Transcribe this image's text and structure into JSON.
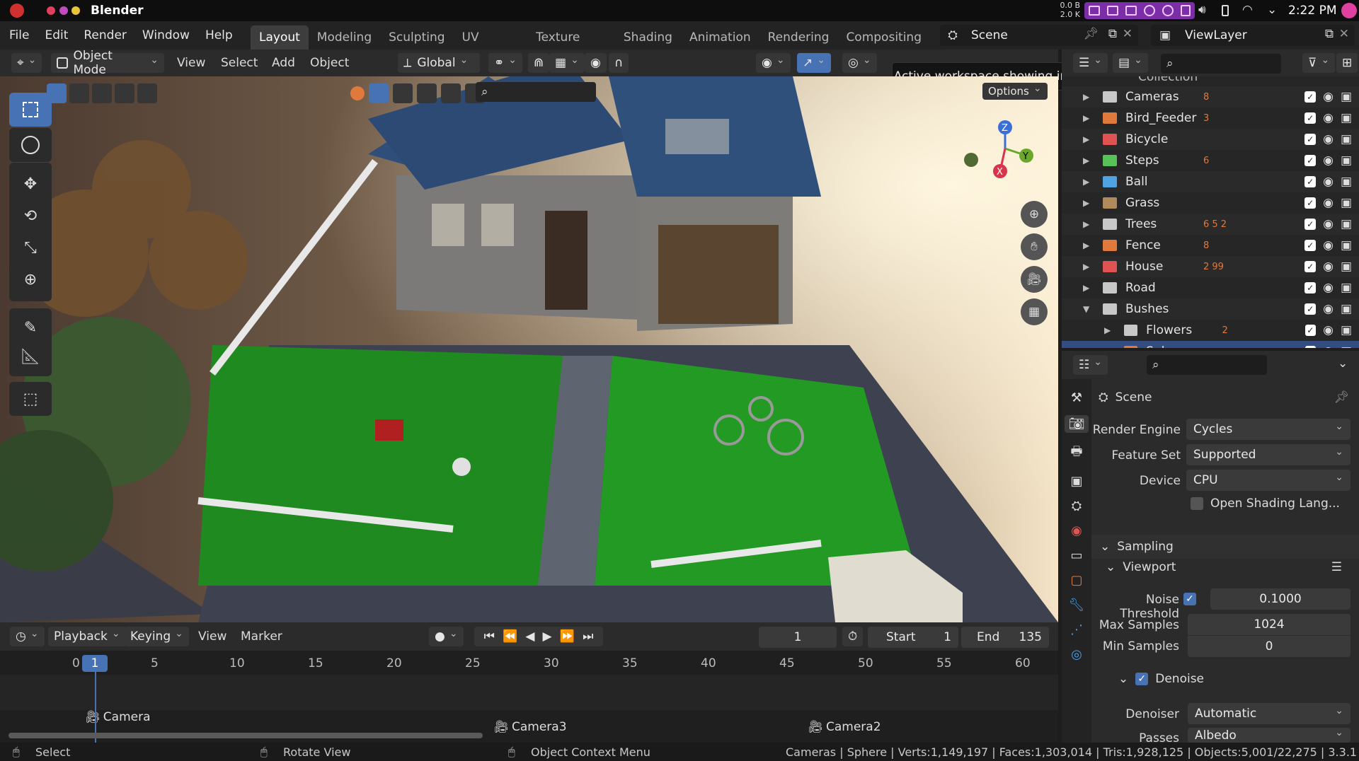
{
  "system": {
    "app_name": "Blender",
    "net_up": "0.0 B",
    "net_down": "2.0 K",
    "time": "2:22 PM"
  },
  "menu": [
    "File",
    "Edit",
    "Render",
    "Window",
    "Help"
  ],
  "workspaces": [
    "Layout",
    "Modeling",
    "Sculpting",
    "UV Editing",
    "Texture Paint",
    "Shading",
    "Animation",
    "Rendering",
    "Compositing"
  ],
  "active_workspace": "Layout",
  "scene_name": "Scene",
  "view_layer": "ViewLayer",
  "tooltip": "Active workspace showing in the window.",
  "viewport_header": {
    "mode": "Object Mode",
    "view": "View",
    "select": "Select",
    "add": "Add",
    "object": "Object",
    "orientation": "Global",
    "options": "Options"
  },
  "outliner": {
    "partial_top": "Collection",
    "rows": [
      {
        "name": "Cameras",
        "color": "#c8c8c8",
        "badges": "8"
      },
      {
        "name": "Bird_Feeder",
        "color": "#e07a3c",
        "badges": "3"
      },
      {
        "name": "Bicycle",
        "color": "#e05353",
        "badges": ""
      },
      {
        "name": "Steps",
        "color": "#5ac15a",
        "badges": "6"
      },
      {
        "name": "Ball",
        "color": "#4fa3e0",
        "badges": ""
      },
      {
        "name": "Grass",
        "color": "#b08a5a",
        "badges": ""
      },
      {
        "name": "Trees",
        "color": "#c8c8c8",
        "badges": "6  5  2"
      },
      {
        "name": "Fence",
        "color": "#e07a3c",
        "badges": "8"
      },
      {
        "name": "House",
        "color": "#e05353",
        "badges": "2  99"
      },
      {
        "name": "Road",
        "color": "#c8c8c8",
        "badges": ""
      },
      {
        "name": "Bushes",
        "color": "#c8c8c8",
        "badges": ""
      },
      {
        "name": "Flowers",
        "color": "#c8c8c8",
        "badges": "2"
      },
      {
        "name": "Sphere",
        "color": "#e07a3c",
        "badges": ""
      }
    ]
  },
  "properties": {
    "context": "Scene",
    "render_engine_label": "Render Engine",
    "render_engine": "Cycles",
    "feature_set_label": "Feature Set",
    "feature_set": "Supported",
    "device_label": "Device",
    "device": "CPU",
    "osl": "Open Shading Lang...",
    "sampling": "Sampling",
    "viewport": "Viewport",
    "noise_threshold_label": "Noise Threshold",
    "noise_threshold": "0.1000",
    "max_samples_label": "Max Samples",
    "max_samples": "1024",
    "min_samples_label": "Min Samples",
    "min_samples": "0",
    "denoise": "Denoise",
    "denoiser_label": "Denoiser",
    "denoiser": "Automatic",
    "passes_label": "Passes",
    "passes": "Albedo"
  },
  "timeline": {
    "playback": "Playback",
    "keying": "Keying",
    "view": "View",
    "marker": "Marker",
    "current_frame": "1",
    "start_label": "Start",
    "start": "1",
    "end_label": "End",
    "end": "135",
    "ticks": [
      "0",
      "5",
      "10",
      "15",
      "20",
      "25",
      "30",
      "35",
      "40",
      "45",
      "50",
      "55",
      "60"
    ],
    "markers": [
      {
        "name": "Camera",
        "frame": 1
      },
      {
        "name": "Camera3",
        "frame": 27
      },
      {
        "name": "Camera2",
        "frame": 47
      }
    ]
  },
  "status": {
    "select": "Select",
    "rotate": "Rotate View",
    "context_menu": "Object Context Menu",
    "stats": "Cameras | Sphere | Verts:1,149,197 | Faces:1,303,014 | Tris:1,928,125 | Objects:5,001/22,275 | 3.3.1"
  }
}
